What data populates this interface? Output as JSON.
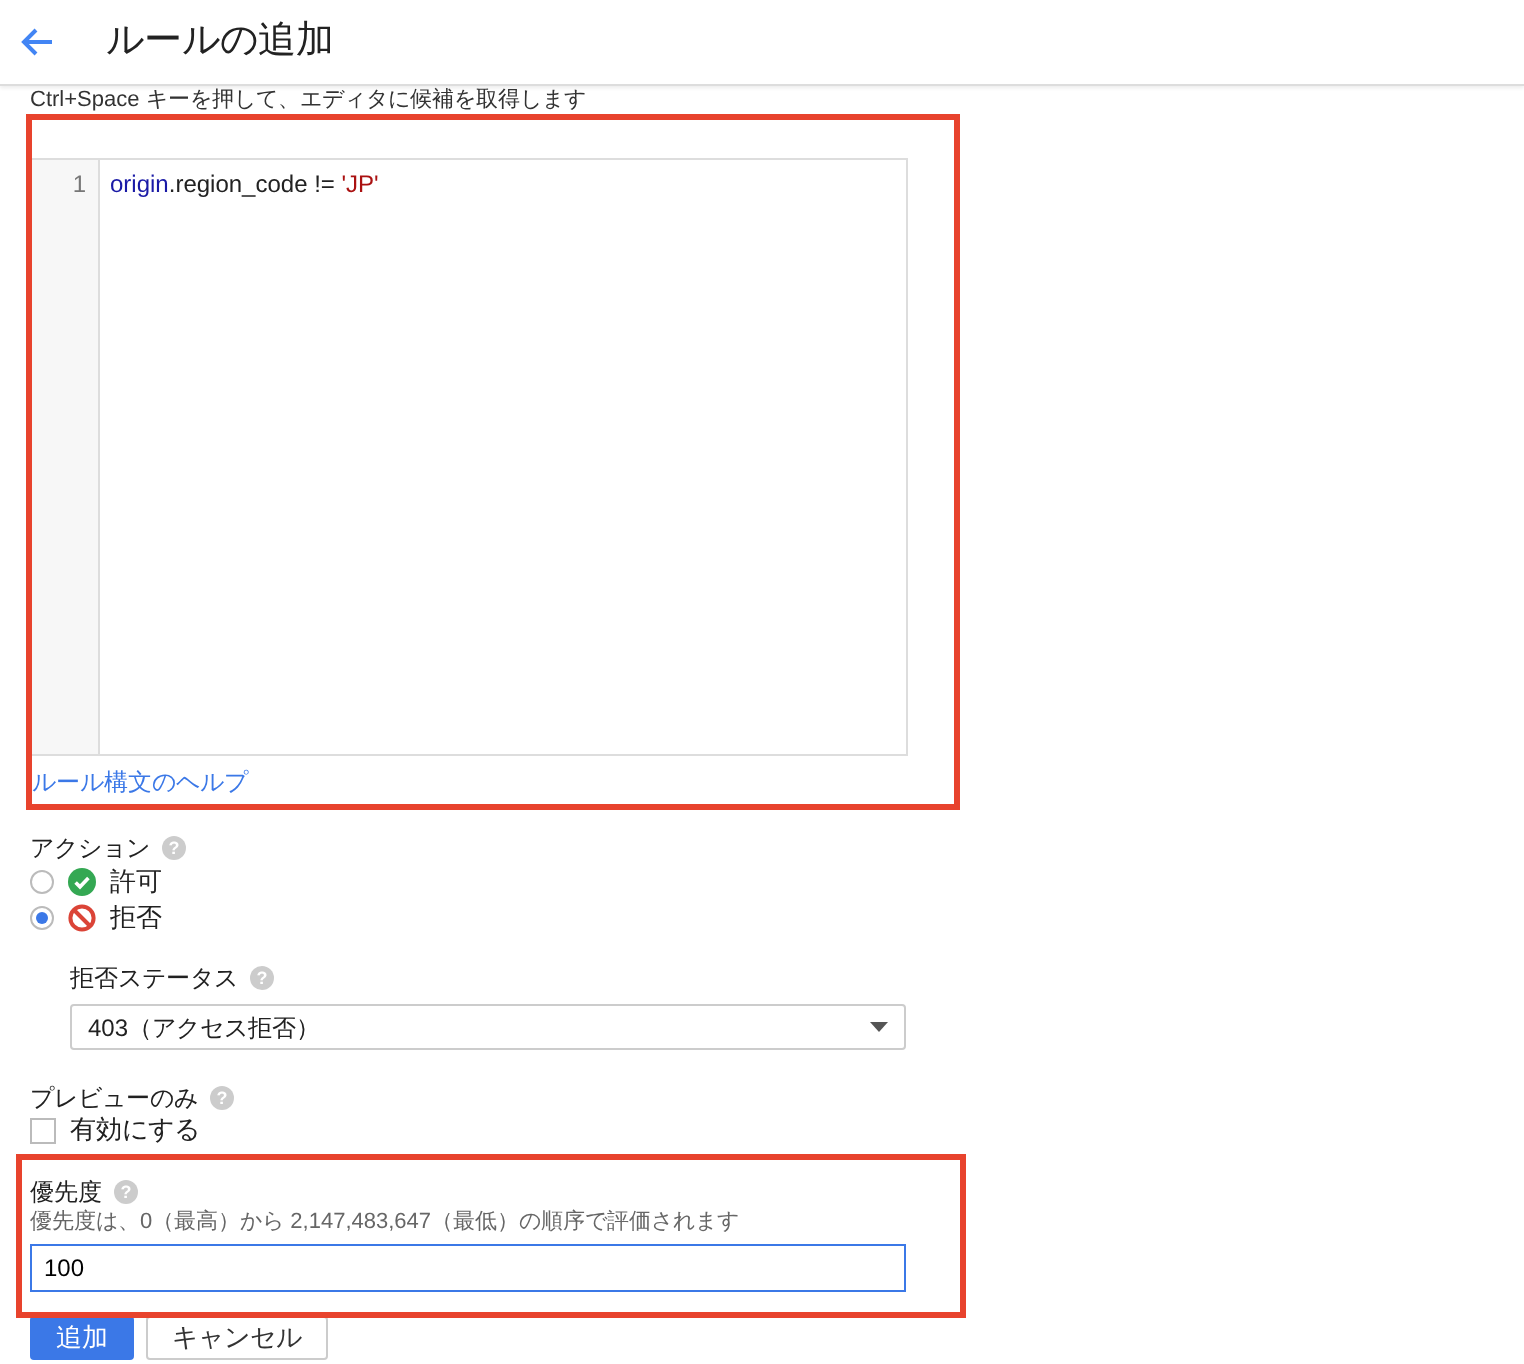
{
  "header": {
    "title": "ルールの追加"
  },
  "editor": {
    "hint": "Ctrl+Space キーを押して、エディタに候補を取得します",
    "lines": [
      {
        "number": "1",
        "tokens": [
          {
            "kind": "variable",
            "text": "origin"
          },
          {
            "kind": "plain",
            "text": ".region_code != "
          },
          {
            "kind": "string",
            "text": "'JP'"
          }
        ]
      }
    ]
  },
  "help_link": "ルール構文のヘルプ",
  "action": {
    "label": "アクション",
    "help_icon": "?",
    "options": [
      {
        "label": "許可",
        "kind": "allow",
        "selected": false
      },
      {
        "label": "拒否",
        "kind": "deny",
        "selected": true
      }
    ]
  },
  "deny_status": {
    "label": "拒否ステータス",
    "help_icon": "?",
    "value": "403（アクセス拒否）"
  },
  "preview": {
    "label": "プレビューのみ",
    "help_icon": "?",
    "checkbox": {
      "label": "有効にする",
      "checked": false
    }
  },
  "priority": {
    "label": "優先度",
    "help_icon": "?",
    "description": "優先度は、0（最高）から 2,147,483,647（最低）の順序で評価されます",
    "value": "100"
  },
  "buttons": [
    {
      "label": "追加",
      "kind": "primary"
    },
    {
      "label": "キャンセル",
      "kind": "secondary"
    }
  ]
}
